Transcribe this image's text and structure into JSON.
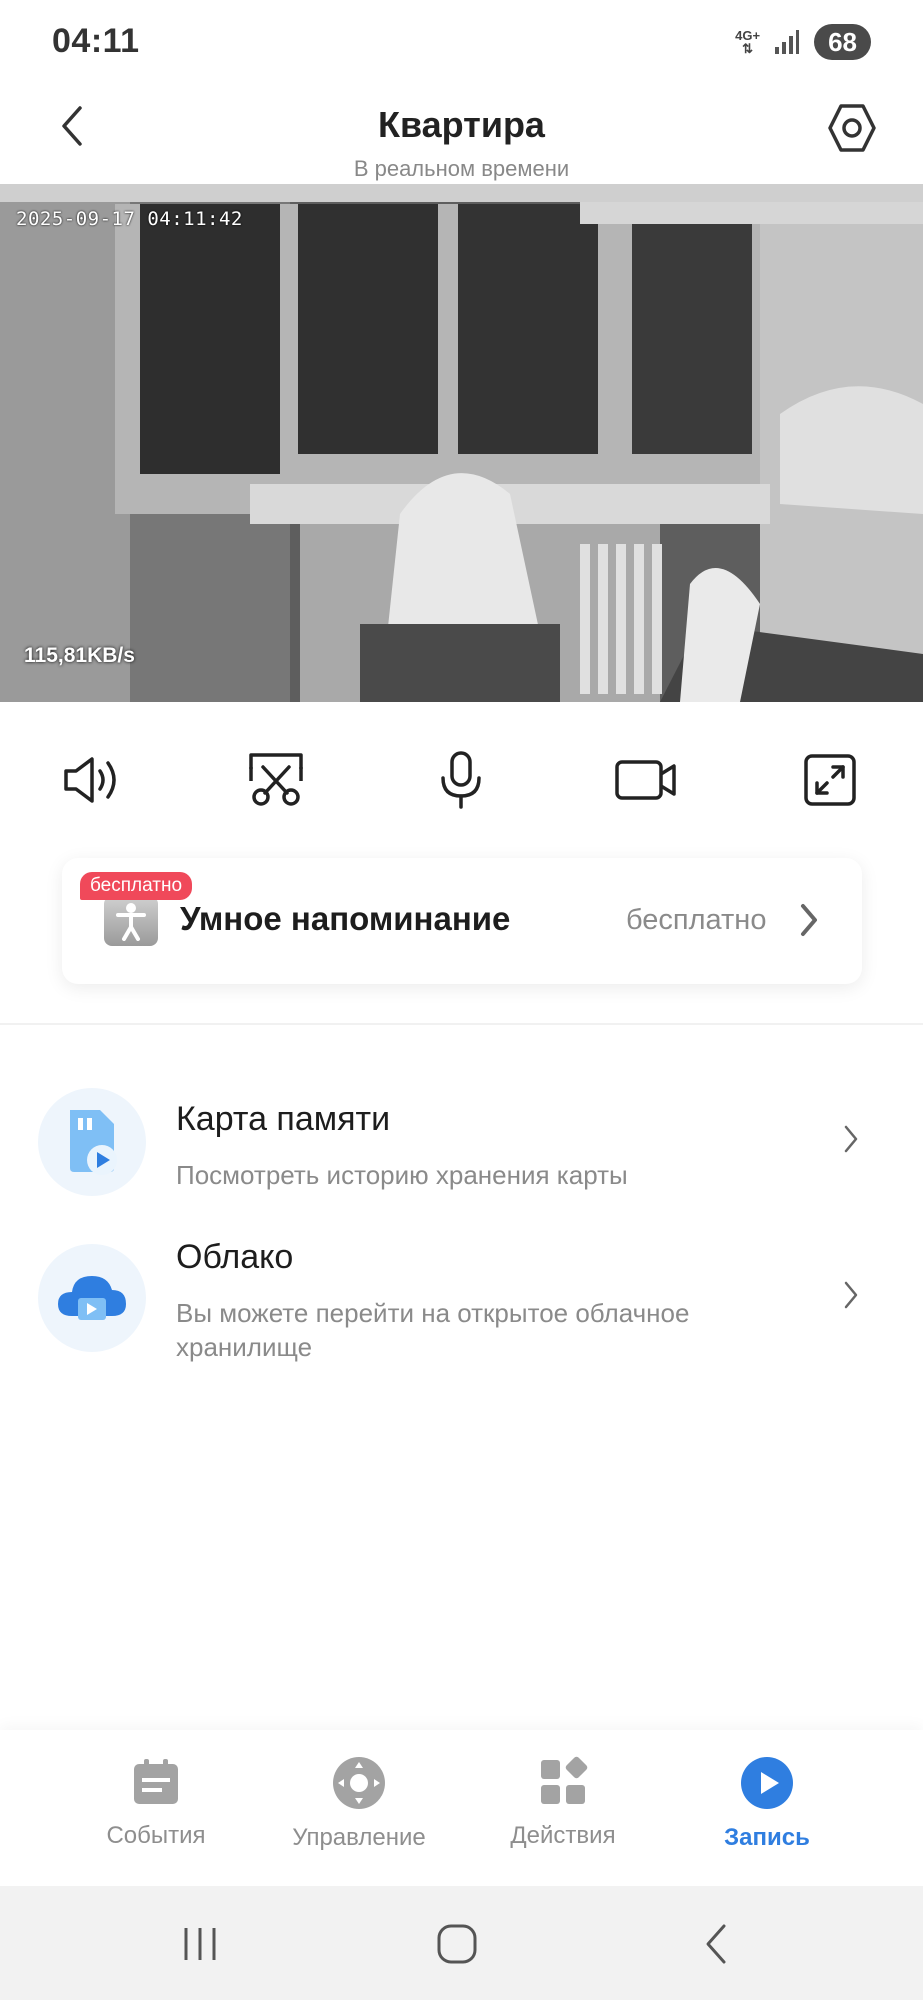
{
  "status_bar": {
    "time": "04:11",
    "network": "4G+",
    "battery": "68"
  },
  "header": {
    "title": "Квартира",
    "subtitle": "В реальном времени",
    "back_icon": "chevron-left-icon",
    "settings_icon": "hexagon-settings-icon"
  },
  "video": {
    "timestamp": "2025-09-17 04:11:42",
    "bitrate": "115,81KB/s"
  },
  "controls": [
    {
      "name": "speaker-icon"
    },
    {
      "name": "screenshot-scissors-icon"
    },
    {
      "name": "microphone-icon"
    },
    {
      "name": "record-video-icon"
    },
    {
      "name": "fullscreen-icon"
    }
  ],
  "smart_reminder": {
    "badge": "бесплатно",
    "title": "Умное напоминание",
    "value": "бесплатно"
  },
  "list": [
    {
      "title": "Карта памяти",
      "description": "Посмотреть историю хранения карты",
      "icon": "sd-card-play-icon"
    },
    {
      "title": "Облако",
      "description": "Вы можете перейти на открытое облачное хранилище",
      "icon": "cloud-play-icon"
    }
  ],
  "bottom_nav": [
    {
      "label": "События",
      "icon": "events-icon",
      "active": false
    },
    {
      "label": "Управление",
      "icon": "control-dpad-icon",
      "active": false
    },
    {
      "label": "Действия",
      "icon": "actions-grid-icon",
      "active": false
    },
    {
      "label": "Запись",
      "icon": "play-circle-icon",
      "active": true
    }
  ],
  "colors": {
    "accent": "#2f7ee0",
    "badge": "#f0495a"
  }
}
